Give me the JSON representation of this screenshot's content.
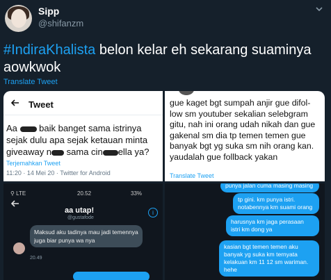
{
  "tweet": {
    "display_name": "Sipp",
    "handle": "@shifanzm",
    "hashtag": "#IndiraKhalista",
    "text": " belon kelar eh sekarang suaminya aowkwok",
    "translate_label": "Translate Tweet"
  },
  "image1": {
    "header": "Tweet",
    "text_line1_start": "Aa ",
    "text_line1_end": " baik banget sama istrinya",
    "text_line2": "sejak dulu apa sejak ketauan minta",
    "text_line3_start": "giveaway n",
    "text_line3_mid": " sama cin",
    "text_line3_end": "ella ya?",
    "translate": "Terjemahkan Tweet",
    "meta": "11:20 · 14 Mei 20 · Twitter for Android"
  },
  "image2": {
    "text": "gue kaget bgt sumpah anjir gue difol-low sm youtuber sekalian selebgram gitu, nah ini orang udah nikah dan gue gakenal sm dia tp temen temen gue banyak bgt yg suka sm nih orang kan. yaudalah gue follback yakan",
    "translate": "Translate Tweet"
  },
  "image3": {
    "status_left": "⚲ LTE",
    "time": "20.52",
    "battery": "33%",
    "contact_name": "aa utap!",
    "contact_handle": "@gustafode",
    "message": "Maksud aku tadinya mau jadi temennya juga biar punya wa nya",
    "stamp": "20.49"
  },
  "image4": {
    "bubble0": "punya jalan cuma masing masing",
    "bubble1": "tp gini. km punya istri. notabennya km suami orang",
    "bubble2": "harusnya km jaga perasaan istri km dong ya",
    "bubble3": "kasian bgt temen temen aku banyak yg suka km ternyata kelakuan km 11 12 sm wariman. hehe"
  }
}
